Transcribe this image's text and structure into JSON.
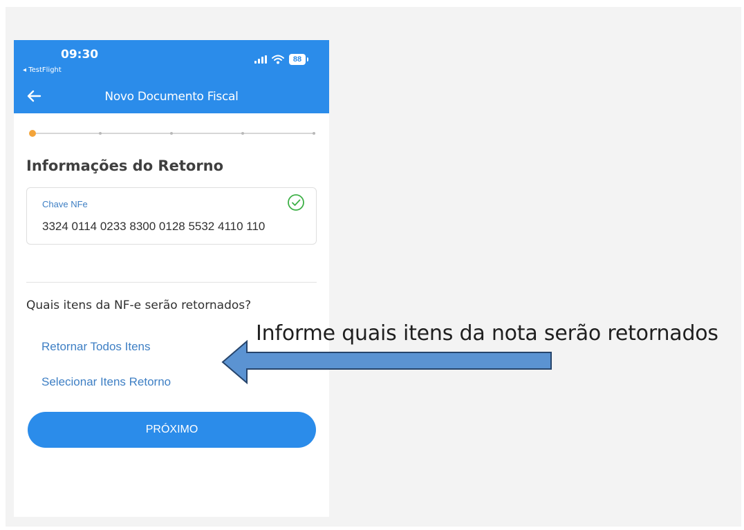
{
  "status_bar": {
    "time": "09:30",
    "back_app": "◂ TestFlight",
    "battery": "88"
  },
  "header": {
    "title": "Novo Documento Fiscal"
  },
  "stepper": {
    "current_step": 1,
    "total_steps": 5
  },
  "form": {
    "section_title": "Informações do Retorno",
    "nfe_field": {
      "label": "Chave NFe",
      "value": "3324 0114 0233 8300 0128 5532 4110 110"
    },
    "question": "Quais itens da NF-e serão retornados?",
    "options": [
      {
        "label": "Retornar Todos Itens"
      },
      {
        "label": "Selecionar Itens Retorno"
      }
    ],
    "next_button": "PRÓXIMO"
  },
  "annotation": {
    "text": "Informe quais itens da nota serão retornados"
  },
  "colors": {
    "primary": "#2b8cea",
    "link": "#3e7fc4",
    "step_active": "#f3a43a",
    "valid": "#3db046",
    "annotation_arrow": "#5b93d2"
  }
}
